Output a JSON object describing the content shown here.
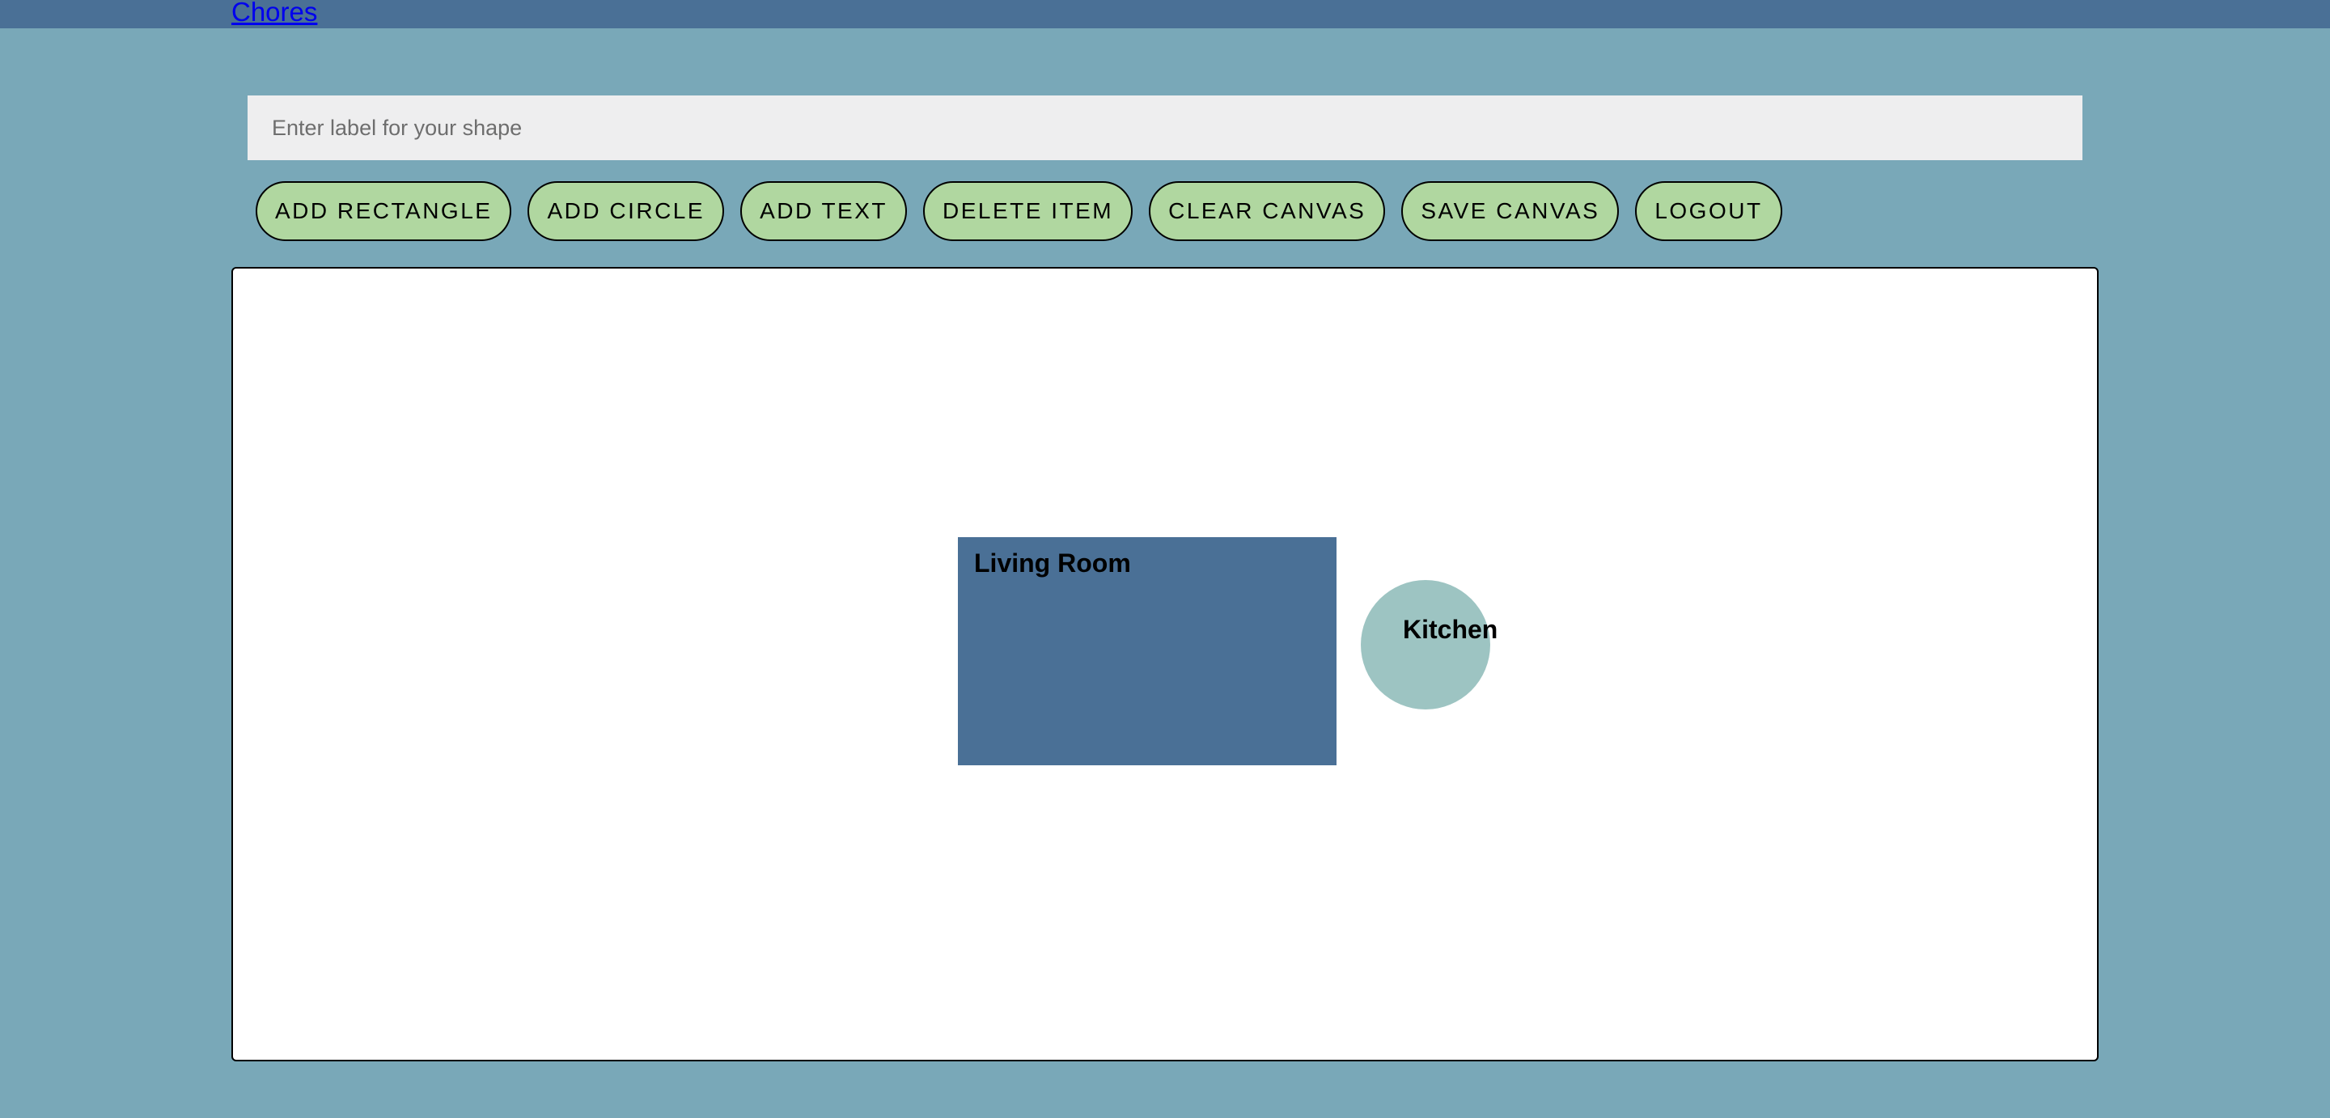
{
  "nav": {
    "link_label": "Chores"
  },
  "label_input": {
    "value": "",
    "placeholder": "Enter label for your shape"
  },
  "toolbar": {
    "buttons": [
      {
        "label": "ADD RECTANGLE"
      },
      {
        "label": "ADD CIRCLE"
      },
      {
        "label": "ADD TEXT"
      },
      {
        "label": "DELETE ITEM"
      },
      {
        "label": "CLEAR CANVAS"
      },
      {
        "label": "SAVE CANVAS"
      },
      {
        "label": "LOGOUT"
      }
    ]
  },
  "canvas": {
    "shapes": [
      {
        "type": "rectangle",
        "label": "Living Room",
        "color": "#4a7096"
      },
      {
        "type": "circle",
        "label": "Kitchen",
        "color": "#9dc4c2"
      }
    ]
  },
  "colors": {
    "page_background": "#79a8b8",
    "top_bar": "#4a7096",
    "button_fill": "#b0d7a0",
    "input_background": "#eeeeef",
    "canvas_background": "#ffffff"
  }
}
